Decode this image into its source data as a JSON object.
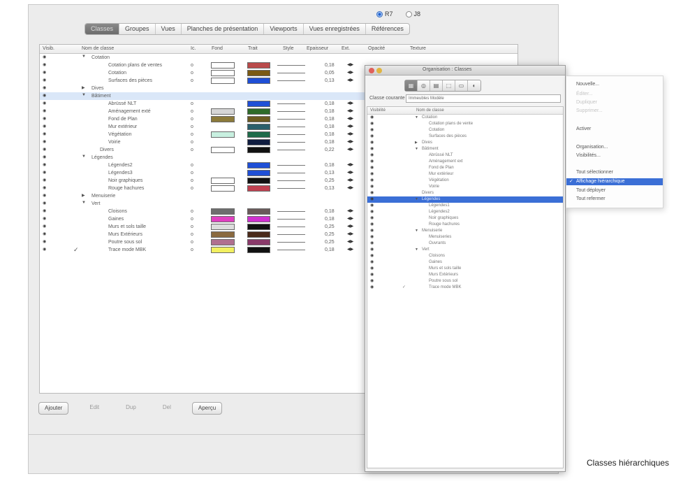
{
  "radio_options": [
    {
      "label": "R7",
      "selected": true
    },
    {
      "label": "J8",
      "selected": false
    }
  ],
  "tabs": [
    {
      "label": "Classes",
      "active": true
    },
    {
      "label": "Groupes",
      "active": false
    },
    {
      "label": "Vues",
      "active": false
    },
    {
      "label": "Planches de présentation",
      "active": false
    },
    {
      "label": "Viewports",
      "active": false
    },
    {
      "label": "Vues enregistrées",
      "active": false
    },
    {
      "label": "Références",
      "active": false
    }
  ],
  "table": {
    "headers": [
      "Visib.",
      "Nom de classe",
      "Ic.",
      "Fond",
      "Trait",
      "Style",
      "Epaisseur",
      "Ext.",
      "Opacité",
      "Texture"
    ],
    "rows": [
      {
        "indent": 1,
        "toggle": "open",
        "name": "Cotation"
      },
      {
        "indent": 3,
        "name": "Cotation plans de ventes",
        "ic": "o",
        "fill": "#ffffff",
        "line": "#b94a4a",
        "thickness": "0,18"
      },
      {
        "indent": 3,
        "name": "Cotation",
        "ic": "o",
        "fill": "#ffffff",
        "line": "#7a5a14",
        "thickness": "0,05"
      },
      {
        "indent": 3,
        "name": "Surfaces des pièces",
        "ic": "o",
        "fill": "#ffffff",
        "line": "#1f4fd6",
        "thickness": "0,13"
      },
      {
        "indent": 1,
        "toggle": "closed",
        "name": "Dives"
      },
      {
        "indent": 1,
        "toggle": "open",
        "name": "Bâtiment",
        "selected": true
      },
      {
        "indent": 3,
        "name": "Abrüssé NLT",
        "ic": "o",
        "fill": "",
        "line": "#1f4fd6",
        "thickness": "0,18"
      },
      {
        "indent": 3,
        "name": "Aménagement exté",
        "ic": "o",
        "fill": "#d6d6d6",
        "line": "#2f6b2a",
        "thickness": "0,18"
      },
      {
        "indent": 3,
        "name": "Fond de Plan",
        "ic": "o",
        "fill": "#8c7a3a",
        "line": "#6b5a20",
        "thickness": "0,18"
      },
      {
        "indent": 3,
        "name": "Mur extérieur",
        "ic": "o",
        "fill": "",
        "line": "#2a5f6b",
        "thickness": "0,18"
      },
      {
        "indent": 3,
        "name": "Végétation",
        "ic": "o",
        "fill": "#c8f0e0",
        "line": "#1f6b4a",
        "thickness": "0,18"
      },
      {
        "indent": 3,
        "name": "Voirie",
        "ic": "o",
        "fill": "",
        "line": "#101d40",
        "thickness": "0,18"
      },
      {
        "indent": 2,
        "name": "Divers",
        "ic": "o",
        "fill": "#ffffff",
        "line": "#111111",
        "thickness": "0,22"
      },
      {
        "indent": 1,
        "toggle": "open",
        "name": "Légendes"
      },
      {
        "indent": 3,
        "name": "Légendes2",
        "ic": "o",
        "fill": "",
        "line": "#1f4fd6",
        "thickness": "0,18"
      },
      {
        "indent": 3,
        "name": "Légendes3",
        "ic": "o",
        "fill": "",
        "line": "#1f4fd6",
        "thickness": "0,13"
      },
      {
        "indent": 3,
        "name": "Noir graphiques",
        "ic": "o",
        "fill": "#ffffff",
        "line": "#111111",
        "thickness": "0,25"
      },
      {
        "indent": 3,
        "name": "Rouge hachures",
        "ic": "o",
        "fill": "#ffffff",
        "line": "#c04050",
        "thickness": "0,13"
      },
      {
        "indent": 1,
        "toggle": "closed",
        "name": "Menuiserie"
      },
      {
        "indent": 1,
        "toggle": "open",
        "name": "Vert"
      },
      {
        "indent": 3,
        "name": "Cloisons",
        "ic": "o",
        "fill": "#6e6e6e",
        "line": "#6a5a5a",
        "thickness": "0,18"
      },
      {
        "indent": 3,
        "name": "Gaines",
        "ic": "o",
        "fill": "#e040c0",
        "line": "#d030d0",
        "thickness": "0,18"
      },
      {
        "indent": 3,
        "name": "Murs et sols taille",
        "ic": "o",
        "fill": "#dddddd",
        "line": "#111111",
        "thickness": "0,25"
      },
      {
        "indent": 3,
        "name": "Murs Extérieurs",
        "ic": "o",
        "fill": "#8a6a40",
        "line": "#4a2a1a",
        "thickness": "0,25"
      },
      {
        "indent": 3,
        "name": "Poutre sous sol",
        "ic": "o",
        "fill": "#b07090",
        "line": "#8a3a6a",
        "thickness": "0,25"
      },
      {
        "indent": 3,
        "name": "Trace mode MBK",
        "ic": "o",
        "fill": "#f2f060",
        "line": "#111111",
        "thickness": "0,18",
        "check": true
      }
    ]
  },
  "buttons": {
    "add": "Ajouter",
    "edit": "Edit",
    "dup": "Dup",
    "del": "Del",
    "preview": "Aperçu"
  },
  "org_window": {
    "title": "Organisation : Classes",
    "search_label": "Classe courante",
    "search_value": "Immeubles Modèle",
    "list_headers": [
      "Visibilité",
      "Nom de classe"
    ],
    "rows": [
      {
        "indent": 1,
        "toggle": "open",
        "name": "Cotation"
      },
      {
        "indent": 2,
        "name": "Cotation plans de vente"
      },
      {
        "indent": 2,
        "name": "Cotation"
      },
      {
        "indent": 2,
        "name": "Surfaces des pièces"
      },
      {
        "indent": 1,
        "toggle": "closed",
        "name": "Dives"
      },
      {
        "indent": 1,
        "toggle": "open",
        "name": "Bâtiment"
      },
      {
        "indent": 2,
        "name": "Abrüssé NLT"
      },
      {
        "indent": 2,
        "name": "Aménagement ext"
      },
      {
        "indent": 2,
        "name": "Fond de Plan"
      },
      {
        "indent": 2,
        "name": "Mur extérieur"
      },
      {
        "indent": 2,
        "name": "Végétation"
      },
      {
        "indent": 2,
        "name": "Voirie"
      },
      {
        "indent": 1,
        "name": "Divers"
      },
      {
        "indent": 1,
        "toggle": "open",
        "name": "Légendes",
        "selected": true
      },
      {
        "indent": 2,
        "name": "Légendes1"
      },
      {
        "indent": 2,
        "name": "Légendes2"
      },
      {
        "indent": 2,
        "name": "Noir graphiques"
      },
      {
        "indent": 2,
        "name": "Rouge hachures"
      },
      {
        "indent": 1,
        "toggle": "open",
        "name": "Menuiserie"
      },
      {
        "indent": 2,
        "name": "Menuiseries"
      },
      {
        "indent": 2,
        "name": "Ouvrants"
      },
      {
        "indent": 1,
        "toggle": "open",
        "name": "Vert"
      },
      {
        "indent": 2,
        "name": "Cloisons"
      },
      {
        "indent": 2,
        "name": "Gaines"
      },
      {
        "indent": 2,
        "name": "Murs et sols taille"
      },
      {
        "indent": 2,
        "name": "Murs Extérieurs"
      },
      {
        "indent": 2,
        "name": "Poutre sous sol"
      },
      {
        "indent": 2,
        "name": "Trace mode MBK",
        "check": true
      }
    ]
  },
  "context_menu": {
    "items": [
      {
        "label": "Nouvelle...",
        "state": "normal"
      },
      {
        "label": "Éditer...",
        "state": "dim"
      },
      {
        "label": "Dupliquer",
        "state": "dim"
      },
      {
        "label": "Supprimer...",
        "state": "dim"
      },
      {
        "label": "Activer",
        "state": "normal"
      },
      {
        "label": "Organisation...",
        "state": "normal"
      },
      {
        "label": "Visibilités...",
        "state": "normal"
      },
      {
        "label": "Tout sélectionner",
        "state": "normal"
      },
      {
        "label": "Affichage hiérarchique",
        "state": "highlighted"
      },
      {
        "label": "Tout déployer",
        "state": "normal"
      },
      {
        "label": "Tout refermer",
        "state": "normal"
      }
    ]
  },
  "caption": "Classes hiérarchiques"
}
